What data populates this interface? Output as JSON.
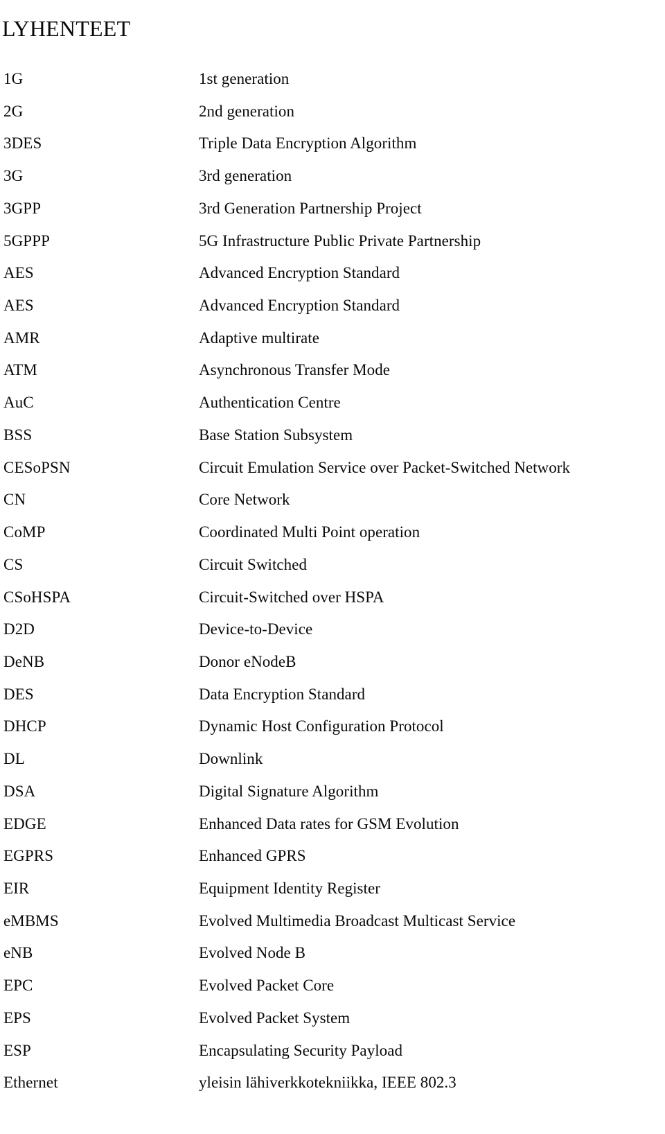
{
  "page": {
    "title": "LYHENTEET",
    "column_headers": {
      "term": "",
      "definition": ""
    }
  },
  "entries": [
    {
      "term": "1G",
      "definition": "1st generation"
    },
    {
      "term": "2G",
      "definition": "2nd generation"
    },
    {
      "term": "3DES",
      "definition": "Triple Data Encryption Algorithm"
    },
    {
      "term": "3G",
      "definition": "3rd generation"
    },
    {
      "term": "3GPP",
      "definition": "3rd Generation Partnership Project"
    },
    {
      "term": "5GPPP",
      "definition": "5G Infrastructure Public Private Partnership"
    },
    {
      "term": "AES",
      "definition": "Advanced Encryption Standard"
    },
    {
      "term": "AES",
      "definition": "Advanced Encryption Standard"
    },
    {
      "term": "AMR",
      "definition": "Adaptive multirate"
    },
    {
      "term": "ATM",
      "definition": "Asynchronous Transfer Mode"
    },
    {
      "term": "AuC",
      "definition": "Authentication Centre"
    },
    {
      "term": "BSS",
      "definition": "Base Station Subsystem"
    },
    {
      "term": "CESoPSN",
      "definition": "Circuit Emulation Service over Packet-Switched Network"
    },
    {
      "term": "CN",
      "definition": "Core Network"
    },
    {
      "term": "CoMP",
      "definition": "Coordinated Multi Point operation"
    },
    {
      "term": "CS",
      "definition": "Circuit Switched"
    },
    {
      "term": "CSoHSPA",
      "definition": "Circuit-Switched over HSPA"
    },
    {
      "term": "D2D",
      "definition": "Device-to-Device"
    },
    {
      "term": "DeNB",
      "definition": "Donor eNodeB"
    },
    {
      "term": "DES",
      "definition": "Data Encryption Standard"
    },
    {
      "term": "DHCP",
      "definition": "Dynamic Host Configuration Protocol"
    },
    {
      "term": "DL",
      "definition": "Downlink"
    },
    {
      "term": "DSA",
      "definition": "Digital Signature Algorithm"
    },
    {
      "term": "EDGE",
      "definition": "Enhanced Data rates for GSM Evolution"
    },
    {
      "term": "EGPRS",
      "definition": "Enhanced GPRS"
    },
    {
      "term": "EIR",
      "definition": "Equipment Identity Register"
    },
    {
      "term": "eMBMS",
      "definition": "Evolved Multimedia Broadcast Multicast Service"
    },
    {
      "term": "eNB",
      "definition": "Evolved Node B"
    },
    {
      "term": "EPC",
      "definition": "Evolved Packet Core"
    },
    {
      "term": "EPS",
      "definition": "Evolved Packet System"
    },
    {
      "term": "ESP",
      "definition": "Encapsulating Security Payload"
    },
    {
      "term": "Ethernet",
      "definition": "yleisin lähiverkkotekniikka, IEEE 802.3"
    }
  ],
  "colors": {
    "text": "#0a0a0a",
    "background": "#ffffff"
  }
}
